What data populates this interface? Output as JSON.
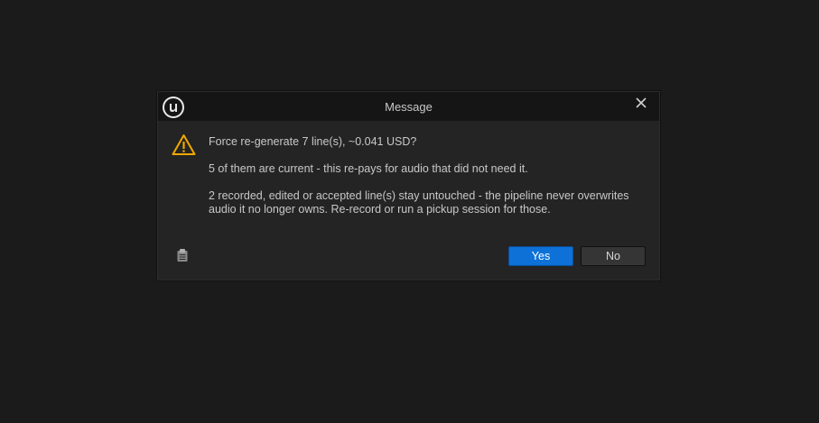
{
  "dialog": {
    "title": "Message",
    "icons": {
      "app": "unreal-logo-icon",
      "close": "close-icon",
      "warning": "warning-icon",
      "copy": "clipboard-icon"
    },
    "message": {
      "line1": "Force re-generate 7 line(s), ~0.041 USD?",
      "line2": "5 of them are current - this re-pays for audio that did not need it.",
      "line3a": "2 recorded, edited or accepted line(s) stay untouched - the pipeline never overwrites",
      "line3b": "audio it no longer owns. Re-record or run a pickup session for those."
    },
    "buttons": {
      "yes": "Yes",
      "no": "No"
    },
    "colors": {
      "accent": "#0e71d8",
      "warning": "#f0a800"
    }
  }
}
